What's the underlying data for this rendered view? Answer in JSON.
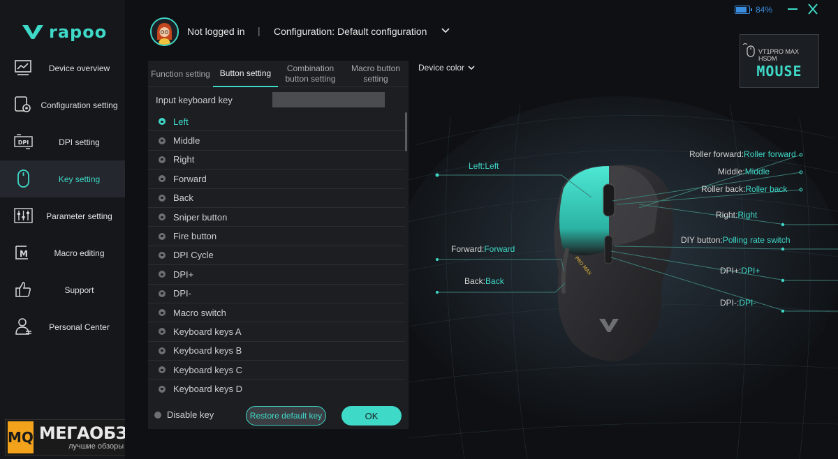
{
  "brand": {
    "name": "rapoo",
    "accent": "#3fd9c8"
  },
  "sidebar": {
    "items": [
      {
        "label": "Device overview",
        "icon": "monitor-chart-icon",
        "active": false
      },
      {
        "label": "Configuration setting",
        "icon": "config-gear-icon",
        "active": false
      },
      {
        "label": "DPI setting",
        "icon": "dpi-icon",
        "active": false
      },
      {
        "label": "Key setting",
        "icon": "mouse-icon",
        "active": true
      },
      {
        "label": "Parameter setting",
        "icon": "sliders-icon",
        "active": false
      },
      {
        "label": "Macro editing",
        "icon": "macro-icon",
        "active": false
      },
      {
        "label": "Support",
        "icon": "thumbs-up-icon",
        "active": false
      },
      {
        "label": "Personal Center",
        "icon": "user-icon",
        "active": false
      }
    ]
  },
  "watermark": {
    "mark": "MQ",
    "title": "МЕГАОБЗОР",
    "subtitle": "лучшие обзоры"
  },
  "header": {
    "login_status": "Not logged in",
    "separator": "|",
    "configuration": "Configuration: Default configuration"
  },
  "battery": {
    "percent_label": "84%",
    "level": 0.84
  },
  "device": {
    "name": "VT1PRO MAX HSDM",
    "type": "MOUSE"
  },
  "tabs": [
    {
      "label": "Function setting",
      "active": false
    },
    {
      "label": "Button setting",
      "active": true
    },
    {
      "label": "Combination button setting",
      "active": false
    },
    {
      "label": "Macro button setting",
      "active": false
    }
  ],
  "input": {
    "label": "Input keyboard key",
    "value": ""
  },
  "options": [
    {
      "label": "Left",
      "selected": true
    },
    {
      "label": "Middle",
      "selected": false
    },
    {
      "label": "Right",
      "selected": false
    },
    {
      "label": "Forward",
      "selected": false
    },
    {
      "label": "Back",
      "selected": false
    },
    {
      "label": "Sniper button",
      "selected": false
    },
    {
      "label": "Fire button",
      "selected": false
    },
    {
      "label": "DPI Cycle",
      "selected": false
    },
    {
      "label": "DPI+",
      "selected": false
    },
    {
      "label": "DPI-",
      "selected": false
    },
    {
      "label": "Macro switch",
      "selected": false
    },
    {
      "label": "Keyboard keys A",
      "selected": false
    },
    {
      "label": "Keyboard keys B",
      "selected": false
    },
    {
      "label": "Keyboard keys C",
      "selected": false
    },
    {
      "label": "Keyboard keys D",
      "selected": false
    }
  ],
  "footer": {
    "disable_label": "Disable key",
    "restore_label": "Restore default key",
    "ok_label": "OK"
  },
  "device_color_label": "Device color",
  "callouts": {
    "left": "Left:Left",
    "roller_forward": {
      "key": "Roller forward:",
      "value": "Roller forward"
    },
    "middle": {
      "key": "Middle:",
      "value": "Middle"
    },
    "roller_back": {
      "key": "Roller back:",
      "value": "Roller back"
    },
    "right": {
      "key": "Right:",
      "value": "Right"
    },
    "diy": {
      "key": "DIY button:",
      "value": "Polling rate switch"
    },
    "dpi_plus": {
      "key": "DPI+:",
      "value": "DPI+"
    },
    "dpi_minus": {
      "key": "DPI-:",
      "value": "DPI-"
    },
    "forward": {
      "key": "Forward:",
      "value": "Forward"
    },
    "back": {
      "key": "Back:",
      "value": "Back"
    }
  },
  "mouse_print": "PRO MAX"
}
